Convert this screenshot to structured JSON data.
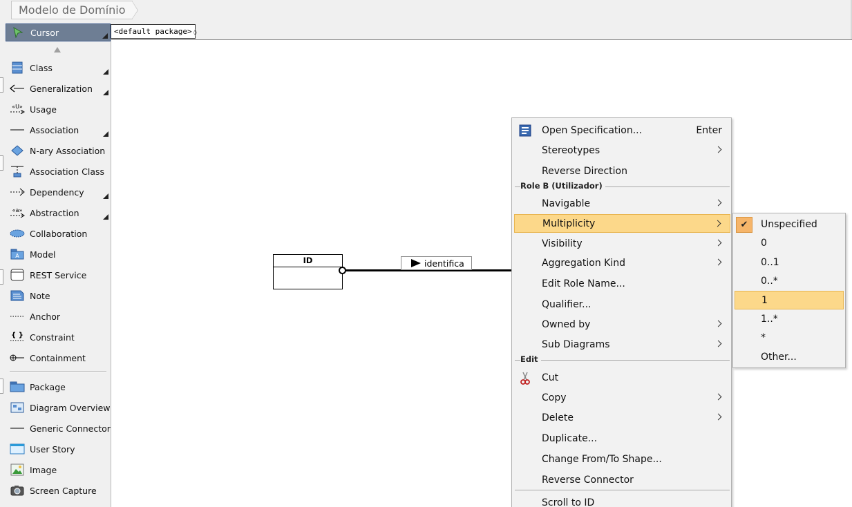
{
  "breadcrumb": {
    "title": "Modelo de Domínio"
  },
  "canvas": {
    "package_label": "<default package>"
  },
  "palette": {
    "items": [
      {
        "label": "Cursor",
        "icon": "cursor-icon"
      },
      {
        "label": "Class",
        "icon": "class-icon"
      },
      {
        "label": "Generalization",
        "icon": "generalization-icon"
      },
      {
        "label": "Usage",
        "icon": "usage-icon"
      },
      {
        "label": "Association",
        "icon": "association-icon"
      },
      {
        "label": "N-ary Association",
        "icon": "nary-association-icon"
      },
      {
        "label": "Association Class",
        "icon": "association-class-icon"
      },
      {
        "label": "Dependency",
        "icon": "dependency-icon"
      },
      {
        "label": "Abstraction",
        "icon": "abstraction-icon"
      },
      {
        "label": "Collaboration",
        "icon": "collaboration-icon"
      },
      {
        "label": "Model",
        "icon": "model-icon"
      },
      {
        "label": "REST Service",
        "icon": "rest-service-icon"
      },
      {
        "label": "Note",
        "icon": "note-icon"
      },
      {
        "label": "Anchor",
        "icon": "anchor-icon"
      },
      {
        "label": "Constraint",
        "icon": "constraint-icon"
      },
      {
        "label": "Containment",
        "icon": "containment-icon"
      },
      {
        "label": "Package",
        "icon": "package-icon"
      },
      {
        "label": "Diagram Overview",
        "icon": "diagram-overview-icon"
      },
      {
        "label": "Generic Connector",
        "icon": "generic-connector-icon"
      },
      {
        "label": "User Story",
        "icon": "user-story-icon"
      },
      {
        "label": "Image",
        "icon": "image-icon"
      },
      {
        "label": "Screen Capture",
        "icon": "screen-capture-icon"
      }
    ],
    "usage_glyph": "«U»",
    "abstraction_glyph": "«a»",
    "constraint_glyph": "{ }",
    "model_glyph": "A"
  },
  "diagram": {
    "class_name": "ID",
    "association_name": "identifica"
  },
  "context_menu": {
    "open_spec": "Open Specification...",
    "open_spec_key": "Enter",
    "stereotypes": "Stereotypes",
    "reverse_direction": "Reverse Direction",
    "section_role": "Role B (Utilizador)",
    "navigable": "Navigable",
    "multiplicity": "Multiplicity",
    "visibility": "Visibility",
    "aggregation_kind": "Aggregation Kind",
    "edit_role_name": "Edit Role Name...",
    "qualifier": "Qualifier...",
    "owned_by": "Owned by",
    "sub_diagrams": "Sub Diagrams",
    "section_edit": "Edit",
    "cut": "Cut",
    "copy": "Copy",
    "delete": "Delete",
    "duplicate": "Duplicate...",
    "change_from_to": "Change From/To Shape...",
    "reverse_connector": "Reverse Connector",
    "scroll_to": "Scroll to ID"
  },
  "multiplicity_submenu": {
    "check_glyph": "✔",
    "options": [
      "Unspecified",
      "0",
      "0..1",
      "0..*",
      "1",
      "1..*",
      "*",
      "Other..."
    ],
    "checked": "Unspecified",
    "highlighted": "1"
  },
  "colors": {
    "highlight": "#fcd88a",
    "selected_palette": "#6e7e94"
  }
}
